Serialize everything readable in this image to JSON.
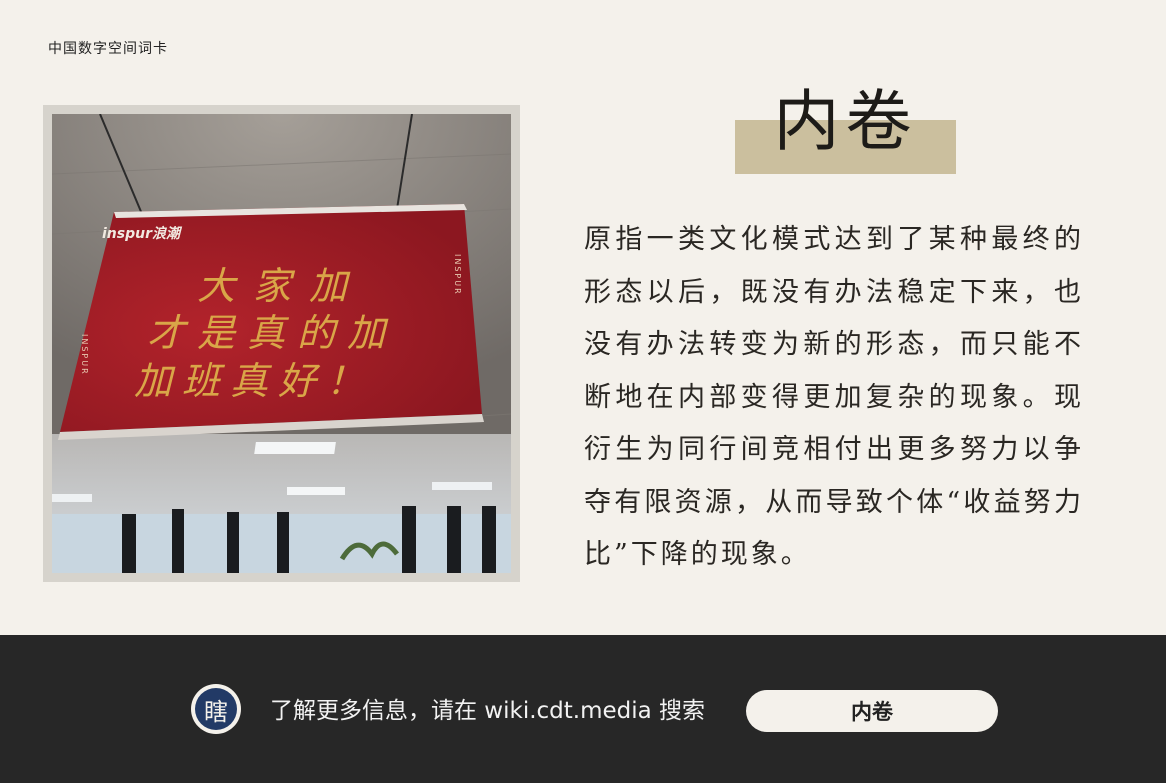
{
  "header": {
    "label": "中国数字空间词卡"
  },
  "photo": {
    "banner_brand": "inspur浪潮",
    "banner_side_text": "INSPUR",
    "banner_lines": [
      "大家加",
      "才是真的加",
      "加班真好！"
    ],
    "colors": {
      "banner_red": "#9e1c26",
      "banner_gold": "#d9a648"
    }
  },
  "entry": {
    "title": "内卷",
    "definition": "原指一类文化模式达到了某种最终的形态以后，既没有办法稳定下来，也没有办法转变为新的形态，而只能不断地在内部变得更加复杂的现象。现衍生为同行间竞相付出更多努力以争夺有限资源，从而导致个体“收益努力比”下降的现象。"
  },
  "footer": {
    "logo_glyph": "瞎",
    "info_text": "了解更多信息，请在 wiki.cdt.media 搜索",
    "search_term": "内卷"
  },
  "colors": {
    "background": "#f4f1eb",
    "title_highlight": "#cbbf9e",
    "footer_bg": "#272727",
    "logo_blue": "#223a66"
  }
}
